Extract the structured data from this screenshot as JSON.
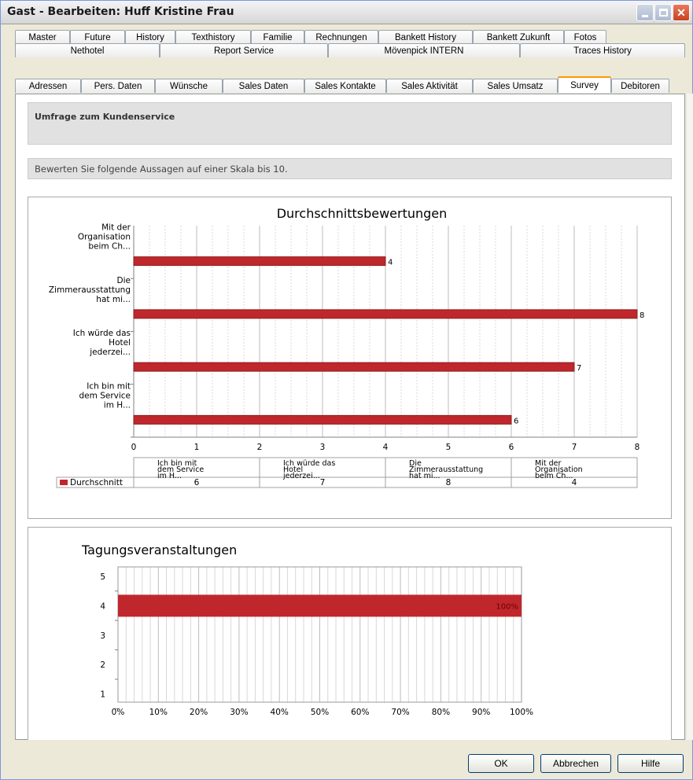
{
  "window": {
    "title": "Gast - Bearbeiten: Huff Kristine Frau"
  },
  "tabs": {
    "row1": [
      "Master",
      "Future",
      "History",
      "Texthistory",
      "Familie",
      "Rechnungen",
      "Bankett History",
      "Bankett Zukunft",
      "Fotos"
    ],
    "row2": [
      "Nethotel",
      "Report Service",
      "Mövenpick INTERN",
      "Traces History"
    ],
    "row3": [
      "Adressen",
      "Pers. Daten",
      "Wünsche",
      "Sales Daten",
      "Sales Kontakte",
      "Sales Aktivität",
      "Sales Umsatz",
      "Survey",
      "Debitoren"
    ],
    "active": "Survey"
  },
  "survey": {
    "heading": "Umfrage zum Kundenservice",
    "instruction": "Bewerten Sie folgende Aussagen auf einer Skala bis 10."
  },
  "chart_data": [
    {
      "type": "bar",
      "orientation": "horizontal",
      "title": "Durchschnittsbewertungen",
      "categories": [
        [
          "Mit der",
          "Organisation",
          "beim Ch..."
        ],
        [
          "Die",
          "Zimmerausstattung",
          "hat mi..."
        ],
        [
          "Ich würde das",
          "Hotel",
          "jederzei..."
        ],
        [
          "Ich bin mit",
          "dem Service",
          "im H..."
        ]
      ],
      "series": [
        {
          "name": "Durchschnitt",
          "values": [
            4,
            8,
            7,
            6
          ],
          "color": "#c0272d"
        }
      ],
      "xlim": [
        0,
        8
      ],
      "xticks": [
        "0",
        "1",
        "2",
        "3",
        "4",
        "5",
        "6",
        "7",
        "8"
      ],
      "grid": true,
      "data_table": {
        "columns": [
          [
            "Ich bin mit",
            "dem Service",
            "im H..."
          ],
          [
            "Ich würde das",
            "Hotel",
            "jederzei..."
          ],
          [
            "Die",
            "Zimmerausstattung",
            "hat mi..."
          ],
          [
            "Mit der",
            "Organisation",
            "beim Ch..."
          ]
        ],
        "values": [
          "6",
          "7",
          "8",
          "4"
        ],
        "legend_label": "Durchschnitt"
      }
    },
    {
      "type": "bar",
      "orientation": "horizontal",
      "title": "Tagungsveranstaltungen",
      "categories": [
        "5",
        "4",
        "3",
        "2",
        "1"
      ],
      "series": [
        {
          "values": [
            0,
            100,
            0,
            0,
            0
          ],
          "color": "#c0272d"
        }
      ],
      "bar_label": "100%",
      "xlim": [
        0,
        100
      ],
      "xticks": [
        "0%",
        "10%",
        "20%",
        "30%",
        "40%",
        "50%",
        "60%",
        "70%",
        "80%",
        "90%",
        "100%"
      ],
      "grid": true
    }
  ],
  "buttons": {
    "ok": "OK",
    "cancel": "Abbrechen",
    "help": "Hilfe"
  }
}
